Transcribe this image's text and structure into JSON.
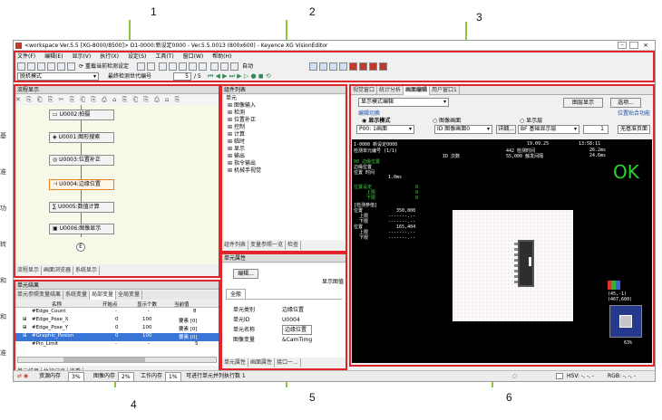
{
  "callouts": [
    "1",
    "2",
    "3",
    "4",
    "5",
    "6"
  ],
  "window": {
    "title": "<workspace Ver.5.5 [XG-8000/8500]> D1-0000:新设定0000 - Ver.5.5.0013 (800x600) - Keyence XG VisionEditor"
  },
  "menu": [
    "文件(F)",
    "编辑(E)",
    "显示(V)",
    "执行(X)",
    "设定(S)",
    "工具(T)",
    "窗口(W)",
    "帮助(H)"
  ],
  "toolbar": {
    "reset_label": "重载当前检测设定",
    "auto_label": "自动",
    "mode_select": "脱机模式",
    "trigger_label": "最终检测世代编号",
    "trigger_value": "5",
    "trigger_total": "/ 5"
  },
  "flow_panel": {
    "title": "流程显示",
    "items": [
      "U0002:拍摄",
      "U0001:图形搜索",
      "U0003:位置补正",
      "U0004:边缘位置",
      "U0005:数值计算",
      "U0006:图像显示"
    ],
    "end_label": "E",
    "tabs": [
      "流程显示",
      "画面浏览器",
      "系统显示"
    ]
  },
  "unit_list": {
    "title": "组件列表",
    "root": "单元",
    "items": [
      "图像输入",
      "检测",
      "位置补正",
      "控制",
      "计算",
      "临时",
      "显示",
      "输出",
      "指令输出",
      "机械手视觉"
    ],
    "tabs": [
      "组件列表",
      "变量参照一览",
      "检查"
    ]
  },
  "result_panel": {
    "title": "单元结果",
    "tabs": [
      "单元参照变量结果",
      "系统变量",
      "局部变量",
      "全局变量"
    ],
    "headers": [
      "名称",
      "开始点",
      "显示个数",
      "当前值"
    ],
    "rows": [
      {
        "name": "#Edge_Count",
        "start": "-",
        "count": "-",
        "value": "8"
      },
      {
        "name": "#Edge_Pose_X",
        "start": "0",
        "count": "100",
        "value": "要素 [0]"
      },
      {
        "name": "#Edge_Pose_Y",
        "start": "0",
        "count": "100",
        "value": "要素 [0]"
      },
      {
        "name": "#Graphic_Posion",
        "start": "0",
        "count": "100",
        "value": "要素 [0]"
      },
      {
        "name": "#Pin_Limit",
        "start": "-",
        "count": "-",
        "value": "5"
      }
    ],
    "bottom_tabs": [
      "单元结果",
      "执行记录",
      "监看"
    ]
  },
  "prop_panel": {
    "title": "单元属性",
    "edit_button": "编辑...",
    "image_label": "显示图值",
    "tab": "全般",
    "rows": [
      {
        "label": "单元类别",
        "value": "边缘位置"
      },
      {
        "label": "单元ID",
        "value": "U0004"
      },
      {
        "label": "单元名称",
        "value": "边缘位置"
      },
      {
        "label": "图像变量",
        "value": "&CamTimg"
      }
    ],
    "bottom_tabs": [
      "单元属性",
      "画面属性",
      "接口一..."
    ]
  },
  "view_panel": {
    "tabs": [
      "视觉窗口",
      "统计分析",
      "画面编辑",
      "用户窗口1"
    ],
    "mode_select": "显示模式编辑",
    "screen_button": "图层显示",
    "option_button": "选项...",
    "switch_label": "编辑切换",
    "radio_display": "显示模式",
    "radio_image": "图像画面",
    "radio_layer": "显示层",
    "screen_select": "P00: 1画面",
    "image_select": "ID 图像画面0",
    "detail_button": "详细...",
    "layer_select": "BF 基础显示层",
    "layer_num": "1",
    "position_label": "位置贴合功能",
    "position_select": "无基准页面"
  },
  "screen": {
    "header_left": "I-0000  新设定0000",
    "date": "19.09.25",
    "time": "13:58:11",
    "line2_left": "检测单元编号 (1/1)",
    "line2_mid": "442  检测时间",
    "line2_right": "26.2ms",
    "line3_mid": "ID 次数",
    "line3_mid2": "55,000  触发间隔",
    "line3_right": "24.6ms",
    "sub1": "00  边缘位置",
    "sub2": "边缘位置",
    "sub3": "位置 时间",
    "sub4": "1.0ms",
    "ok": "OK",
    "block1": [
      "位置设定",
      "上限",
      "下限"
    ],
    "block1_vals": [
      "0",
      "8",
      "8"
    ],
    "block2_title": "[检测参值]",
    "block2": [
      "位置",
      "上限",
      "下限",
      "位置",
      "上限",
      "下限"
    ],
    "block2_vals": [
      "350,000",
      "-------.--",
      "-------.--",
      "165,404",
      "-------.--",
      "-------.--"
    ],
    "br1": "(45,-1)",
    "br2": "(467,600)",
    "pct": "63%"
  },
  "status": {
    "resource": "资源内存",
    "resource_val": "3%",
    "image": "图像内存",
    "image_val": "2%",
    "work": "工作内存",
    "work_val": "1%",
    "msg": "可进行单元并列执行数 1",
    "hsv": "HSV: -, -, -",
    "rgb": "RGB: -, -, -"
  },
  "side_text": [
    "基",
    "准",
    "功",
    "转",
    "和",
    "和",
    "准",
    "行",
    "化"
  ]
}
